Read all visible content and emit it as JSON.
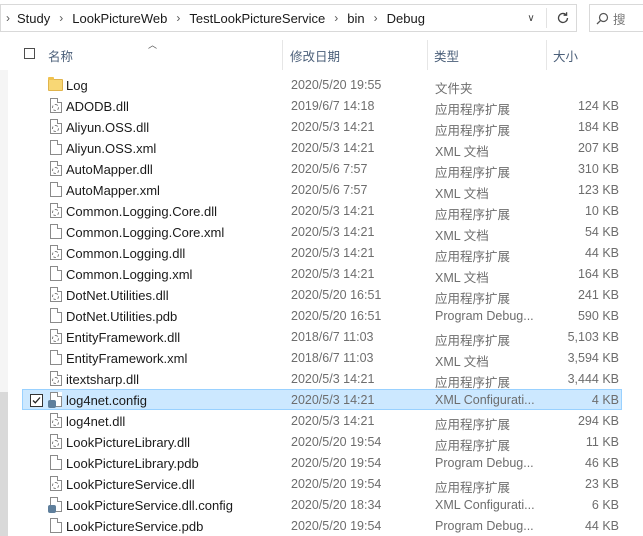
{
  "address": {
    "crumbs": [
      "Study",
      "LookPictureWeb",
      "TestLookPictureService",
      "bin",
      "Debug"
    ]
  },
  "search": {
    "placeholder": "搜"
  },
  "columns": {
    "name": "名称",
    "date": "修改日期",
    "type": "类型",
    "size": "大小"
  },
  "files": [
    {
      "name": "Log",
      "date": "2020/5/20 19:55",
      "type": "文件夹",
      "size": "",
      "icon": "folder-icon"
    },
    {
      "name": "ADODB.dll",
      "date": "2019/6/7 14:18",
      "type": "应用程序扩展",
      "size": "124 KB",
      "icon": "dll-file-icon"
    },
    {
      "name": "Aliyun.OSS.dll",
      "date": "2020/5/3 14:21",
      "type": "应用程序扩展",
      "size": "184 KB",
      "icon": "dll-file-icon"
    },
    {
      "name": "Aliyun.OSS.xml",
      "date": "2020/5/3 14:21",
      "type": "XML 文档",
      "size": "207 KB",
      "icon": "file-icon"
    },
    {
      "name": "AutoMapper.dll",
      "date": "2020/5/6 7:57",
      "type": "应用程序扩展",
      "size": "310 KB",
      "icon": "dll-file-icon"
    },
    {
      "name": "AutoMapper.xml",
      "date": "2020/5/6 7:57",
      "type": "XML 文档",
      "size": "123 KB",
      "icon": "file-icon"
    },
    {
      "name": "Common.Logging.Core.dll",
      "date": "2020/5/3 14:21",
      "type": "应用程序扩展",
      "size": "10 KB",
      "icon": "dll-file-icon"
    },
    {
      "name": "Common.Logging.Core.xml",
      "date": "2020/5/3 14:21",
      "type": "XML 文档",
      "size": "54 KB",
      "icon": "file-icon"
    },
    {
      "name": "Common.Logging.dll",
      "date": "2020/5/3 14:21",
      "type": "应用程序扩展",
      "size": "44 KB",
      "icon": "dll-file-icon"
    },
    {
      "name": "Common.Logging.xml",
      "date": "2020/5/3 14:21",
      "type": "XML 文档",
      "size": "164 KB",
      "icon": "file-icon"
    },
    {
      "name": "DotNet.Utilities.dll",
      "date": "2020/5/20 16:51",
      "type": "应用程序扩展",
      "size": "241 KB",
      "icon": "dll-file-icon"
    },
    {
      "name": "DotNet.Utilities.pdb",
      "date": "2020/5/20 16:51",
      "type": "Program Debug...",
      "size": "590 KB",
      "icon": "file-icon"
    },
    {
      "name": "EntityFramework.dll",
      "date": "2018/6/7 11:03",
      "type": "应用程序扩展",
      "size": "5,103 KB",
      "icon": "dll-file-icon"
    },
    {
      "name": "EntityFramework.xml",
      "date": "2018/6/7 11:03",
      "type": "XML 文档",
      "size": "3,594 KB",
      "icon": "file-icon"
    },
    {
      "name": "itextsharp.dll",
      "date": "2020/5/3 14:21",
      "type": "应用程序扩展",
      "size": "3,444 KB",
      "icon": "dll-file-icon"
    },
    {
      "name": "log4net.config",
      "date": "2020/5/3 14:21",
      "type": "XML Configurati...",
      "size": "4 KB",
      "icon": "config-file-icon",
      "selected": true
    },
    {
      "name": "log4net.dll",
      "date": "2020/5/3 14:21",
      "type": "应用程序扩展",
      "size": "294 KB",
      "icon": "dll-file-icon"
    },
    {
      "name": "LookPictureLibrary.dll",
      "date": "2020/5/20 19:54",
      "type": "应用程序扩展",
      "size": "11 KB",
      "icon": "dll-file-icon"
    },
    {
      "name": "LookPictureLibrary.pdb",
      "date": "2020/5/20 19:54",
      "type": "Program Debug...",
      "size": "46 KB",
      "icon": "file-icon"
    },
    {
      "name": "LookPictureService.dll",
      "date": "2020/5/20 19:54",
      "type": "应用程序扩展",
      "size": "23 KB",
      "icon": "dll-file-icon"
    },
    {
      "name": "LookPictureService.dll.config",
      "date": "2020/5/20 18:34",
      "type": "XML Configurati...",
      "size": "6 KB",
      "icon": "config-file-icon"
    },
    {
      "name": "LookPictureService.pdb",
      "date": "2020/5/20 19:54",
      "type": "Program Debug...",
      "size": "44 KB",
      "icon": "file-icon"
    }
  ]
}
